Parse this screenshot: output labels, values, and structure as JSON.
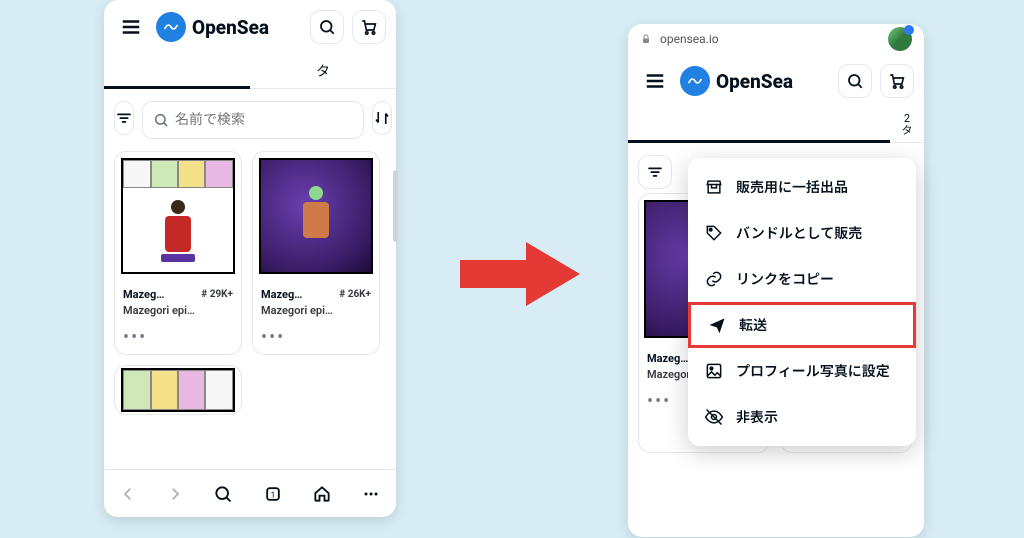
{
  "brand": "OpenSea",
  "left": {
    "tab_label": "タ",
    "search_placeholder": "名前で検索",
    "cards": [
      {
        "title": "Mazeg…",
        "badge": "# 29K+",
        "subtitle": "Mazegori epi…"
      },
      {
        "title": "Mazeg…",
        "badge": "# 26K+",
        "subtitle": "Mazegori epi…"
      }
    ],
    "more": "•••"
  },
  "right": {
    "url": "opensea.io",
    "tab_label_1": "2",
    "tab_label_2": "タ",
    "card": {
      "title": "Mazeg…",
      "subtitle": "Mazegori epi…"
    },
    "more": "•••",
    "menu": [
      {
        "label": "販売用に一括出品",
        "icon": "storefront"
      },
      {
        "label": "バンドルとして販売",
        "icon": "tag"
      },
      {
        "label": "リンクをコピー",
        "icon": "link"
      },
      {
        "label": "転送",
        "icon": "send",
        "highlighted": true
      },
      {
        "label": "プロフィール写真に設定",
        "icon": "image"
      },
      {
        "label": "非表示",
        "icon": "eye-off"
      }
    ]
  }
}
